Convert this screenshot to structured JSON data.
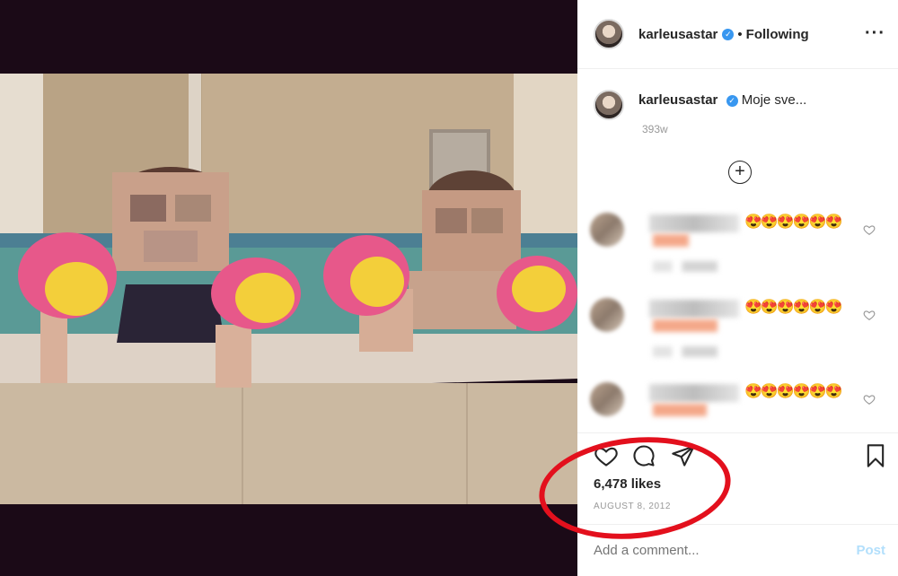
{
  "post": {
    "username": "karleusastar",
    "follow_separator": "•",
    "follow_status": "Following",
    "more_label": "···",
    "verified_symbol": "✓"
  },
  "caption": {
    "username": "karleusastar",
    "text": "Moje sve...",
    "time": "393w"
  },
  "load_more_symbol": "+",
  "comments": [
    {
      "emojis": "😍😍😍😍😍😍"
    },
    {
      "emojis": "😍😍😍😍😍😍"
    },
    {
      "emojis": "😍😍😍😍😍😍"
    }
  ],
  "stats": {
    "likes": "6,478 likes",
    "date": "AUGUST 8, 2012"
  },
  "composer": {
    "placeholder": "Add a comment...",
    "post_label": "Post"
  },
  "colors": {
    "accent_blue": "#3897f0",
    "annotation_red": "#e3101d",
    "post_disabled": "#b2dffc"
  }
}
